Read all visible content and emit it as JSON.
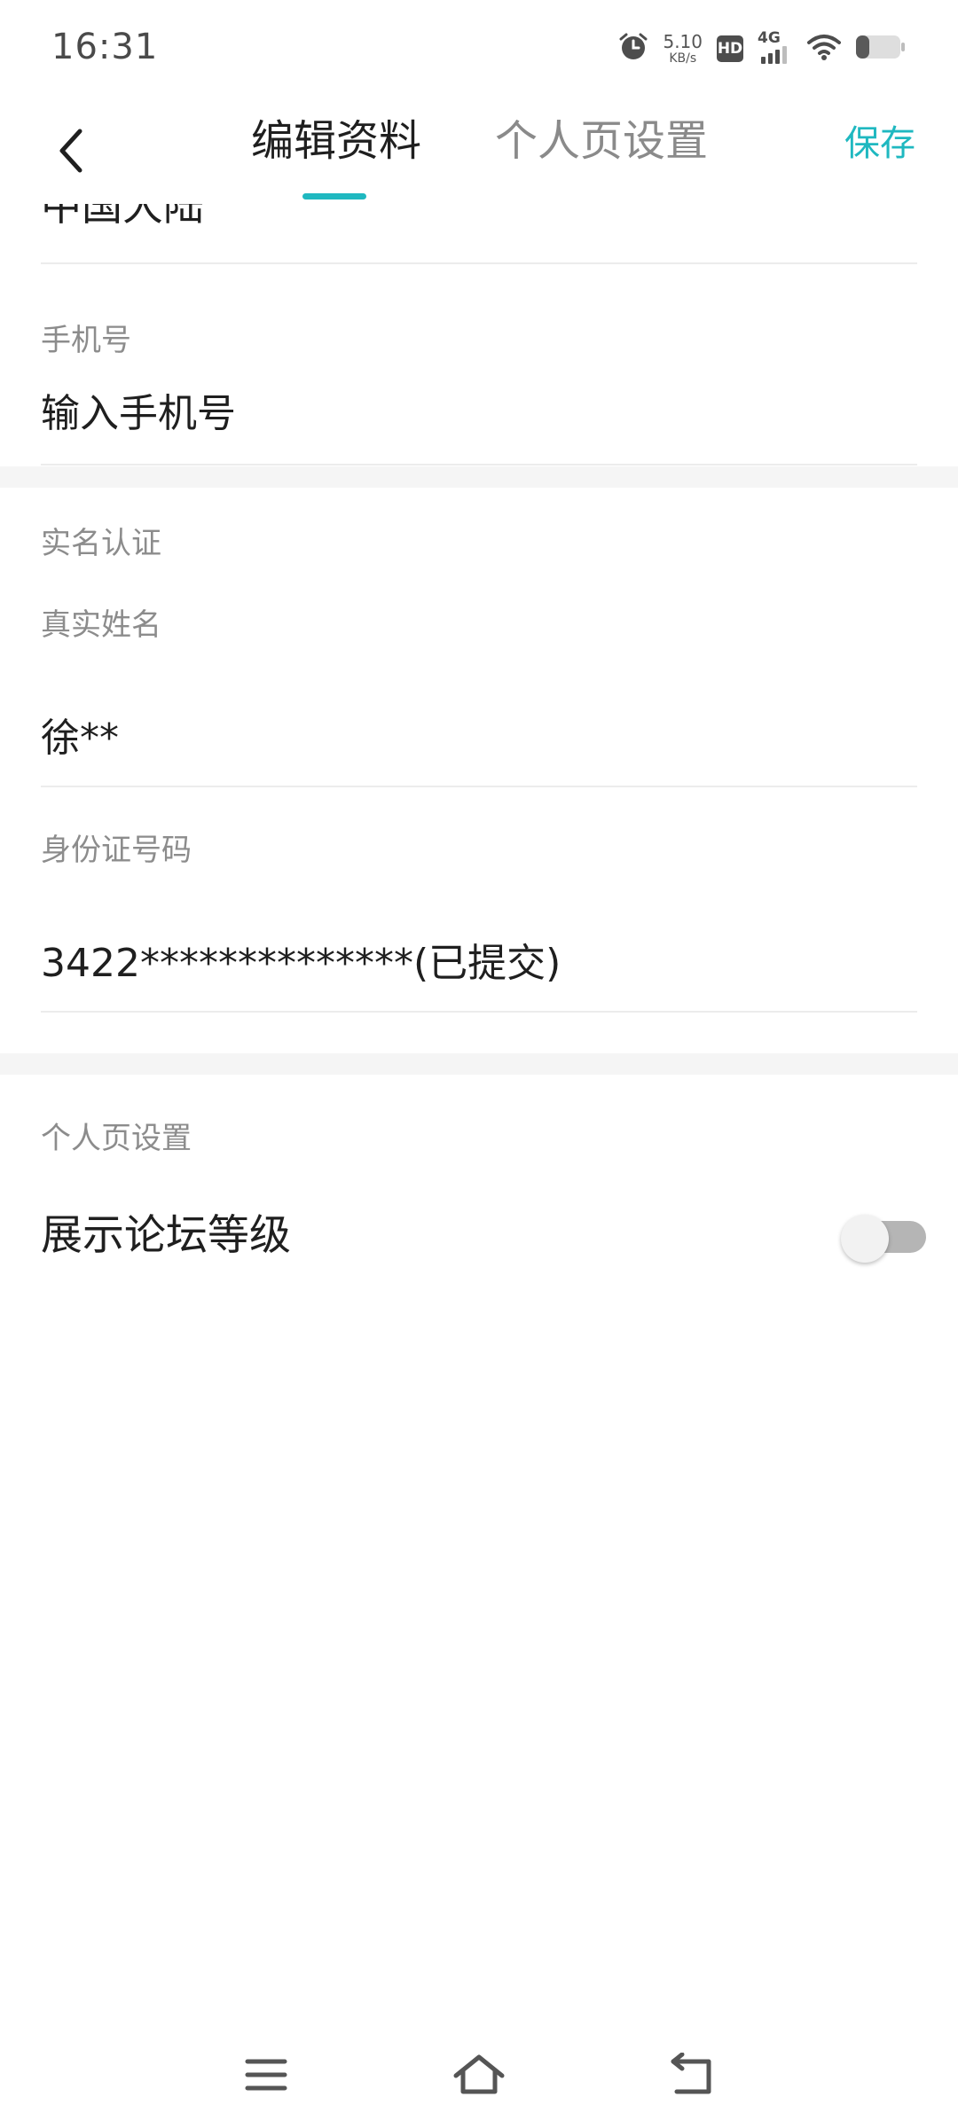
{
  "status_bar": {
    "time": "16:31",
    "net_speed_value": "5.10",
    "net_speed_unit": "KB/s",
    "hd_label": "HD",
    "network_type": "4G",
    "battery_level": 0.3
  },
  "nav": {
    "tabs": [
      {
        "label": "编辑资料",
        "active": true
      },
      {
        "label": "个人页设置",
        "active": false
      }
    ],
    "save_label": "保存"
  },
  "profile": {
    "clipped_value": "中国大陆",
    "phone": {
      "label": "手机号",
      "placeholder": "输入手机号"
    }
  },
  "real_name_auth": {
    "section_title": "实名认证",
    "name_label": "真实姓名",
    "name_value": "徐**",
    "id_label": "身份证号码",
    "id_value": "3422**************(已提交)"
  },
  "personal_page": {
    "section_title": "个人页设置",
    "forum_level_label": "展示论坛等级",
    "forum_level_enabled": false
  },
  "colors": {
    "accent": "#1fb8c0",
    "text_primary": "#1f1f1f",
    "text_secondary": "#8c8c8c",
    "divider": "#ececec",
    "section_gap": "#f5f5f5"
  }
}
